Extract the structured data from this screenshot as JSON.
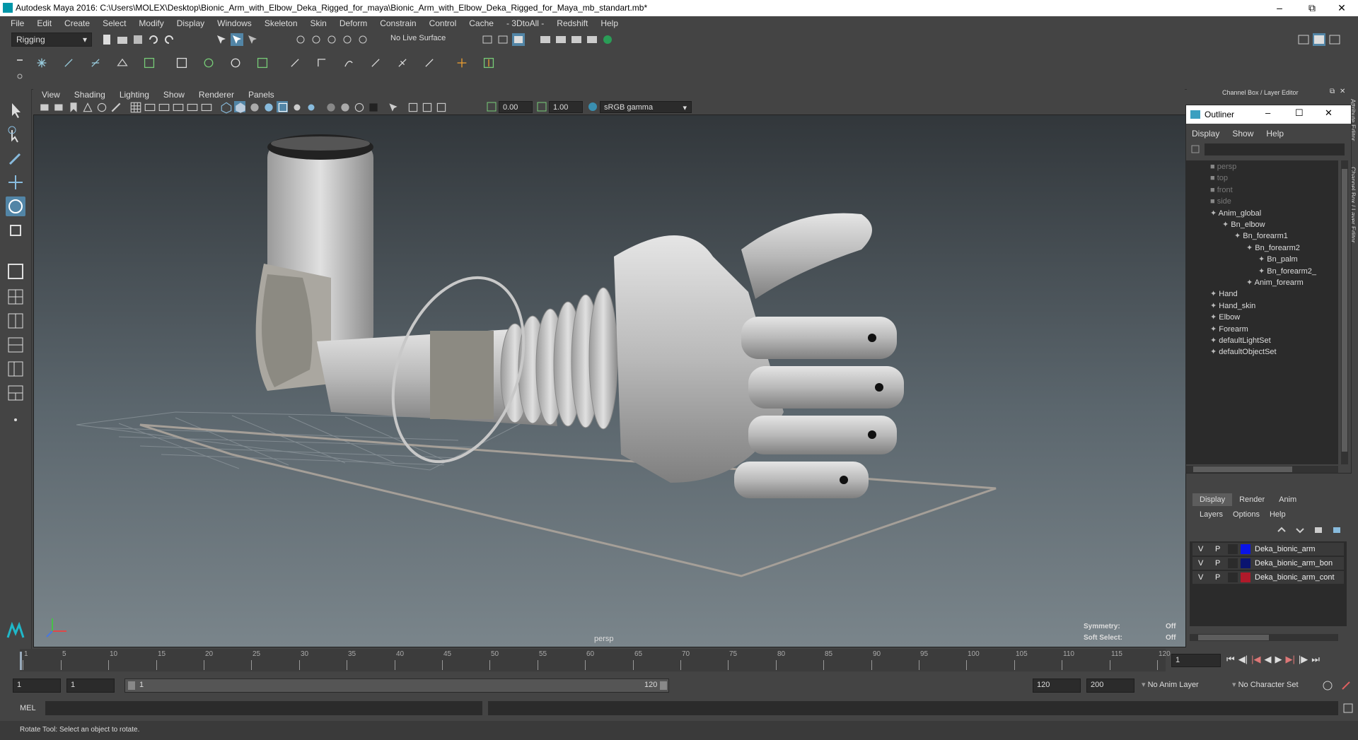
{
  "window": {
    "title": "Autodesk Maya 2016: C:\\Users\\MOLEX\\Desktop\\Bionic_Arm_with_Elbow_Deka_Rigged_for_maya\\Bionic_Arm_with_Elbow_Deka_Rigged_for_Maya_mb_standart.mb*"
  },
  "menubar": [
    "File",
    "Edit",
    "Create",
    "Select",
    "Modify",
    "Display",
    "Windows",
    "Skeleton",
    "Skin",
    "Deform",
    "Constrain",
    "Control",
    "Cache",
    "- 3DtoAll -",
    "Redshift",
    "Help"
  ],
  "statusline": {
    "menuset": "Rigging",
    "live_surface": "No Live Surface"
  },
  "panel_menu": [
    "View",
    "Shading",
    "Lighting",
    "Show",
    "Renderer",
    "Panels"
  ],
  "panel_toolbar": {
    "exposure": "0.00",
    "gamma": "1.00",
    "colorspace": "sRGB gamma"
  },
  "viewport": {
    "camera": "persp",
    "symmetry_label": "Symmetry:",
    "symmetry_value": "Off",
    "soft_select_label": "Soft Select:",
    "soft_select_value": "Off"
  },
  "right_panel": {
    "title": "Channel Box / Layer Editor",
    "side_tabs": [
      "Attribute Editor",
      "Channel Box / Layer Editor"
    ]
  },
  "outliner": {
    "title": "Outliner",
    "menu": [
      "Display",
      "Show",
      "Help"
    ],
    "items": [
      {
        "label": "persp",
        "depth": 0,
        "dim": true
      },
      {
        "label": "top",
        "depth": 0,
        "dim": true
      },
      {
        "label": "front",
        "depth": 0,
        "dim": true
      },
      {
        "label": "side",
        "depth": 0,
        "dim": true
      },
      {
        "label": "Anim_global",
        "depth": 0,
        "dim": false
      },
      {
        "label": "Bn_elbow",
        "depth": 1,
        "dim": false
      },
      {
        "label": "Bn_forearm1",
        "depth": 2,
        "dim": false
      },
      {
        "label": "Bn_forearm2",
        "depth": 3,
        "dim": false
      },
      {
        "label": "Bn_palm",
        "depth": 4,
        "dim": false
      },
      {
        "label": "Bn_forearm2_",
        "depth": 4,
        "dim": false
      },
      {
        "label": "Anim_forearm",
        "depth": 3,
        "dim": false
      },
      {
        "label": "Hand",
        "depth": 0,
        "dim": false
      },
      {
        "label": "Hand_skin",
        "depth": 0,
        "dim": false
      },
      {
        "label": "Elbow",
        "depth": 0,
        "dim": false
      },
      {
        "label": "Forearm",
        "depth": 0,
        "dim": false
      },
      {
        "label": "defaultLightSet",
        "depth": 0,
        "dim": false
      },
      {
        "label": "defaultObjectSet",
        "depth": 0,
        "dim": false
      }
    ]
  },
  "layer_editor": {
    "tabs": [
      "Display",
      "Render",
      "Anim"
    ],
    "menu": [
      "Layers",
      "Options",
      "Help"
    ],
    "layers": [
      {
        "v": "V",
        "p": "P",
        "color": "#0a14e6",
        "name": "Deka_bionic_arm"
      },
      {
        "v": "V",
        "p": "P",
        "color": "#0a1470",
        "name": "Deka_bionic_arm_bon"
      },
      {
        "v": "V",
        "p": "P",
        "color": "#b01a2a",
        "name": "Deka_bionic_arm_cont"
      }
    ]
  },
  "timeline": {
    "ticks": [
      "1",
      "5",
      "10",
      "15",
      "20",
      "25",
      "30",
      "35",
      "40",
      "45",
      "50",
      "55",
      "60",
      "65",
      "70",
      "75",
      "80",
      "85",
      "90",
      "95",
      "100",
      "105",
      "110",
      "115",
      "120"
    ],
    "current_frame": "1"
  },
  "range": {
    "start": "1",
    "playback_start": "1",
    "slider_start": "1",
    "slider_end": "120",
    "playback_end": "120",
    "end": "200",
    "anim_layer": "No Anim Layer",
    "char_set": "No Character Set"
  },
  "cmdline": {
    "label": "MEL"
  },
  "helpline": {
    "text": "Rotate Tool: Select an object to rotate."
  }
}
